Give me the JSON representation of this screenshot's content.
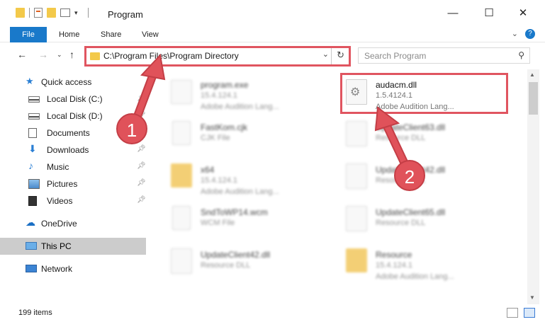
{
  "window": {
    "title": "Program",
    "minimize_glyph": "—",
    "maximize_glyph": "☐",
    "close_glyph": "✕"
  },
  "ribbon": {
    "tabs": [
      "File",
      "Home",
      "Share",
      "View"
    ],
    "help_glyph": "?"
  },
  "address": {
    "path": "C:\\Program Files\\Program Directory"
  },
  "search": {
    "placeholder": "Search Program"
  },
  "sidebar": {
    "items": [
      {
        "label": "Quick access",
        "icon": "star-icon"
      },
      {
        "label": "Local Disk (C:)",
        "icon": "drive-icon"
      },
      {
        "label": "Local Disk (D:)",
        "icon": "drive-icon"
      },
      {
        "label": "Documents",
        "icon": "documents-icon"
      },
      {
        "label": "Downloads",
        "icon": "download-icon"
      },
      {
        "label": "Music",
        "icon": "music-icon"
      },
      {
        "label": "Pictures",
        "icon": "pictures-icon"
      },
      {
        "label": "Videos",
        "icon": "videos-icon"
      },
      {
        "label": "OneDrive",
        "icon": "cloud-icon"
      },
      {
        "label": "This PC",
        "icon": "computer-icon"
      },
      {
        "label": "Network",
        "icon": "network-icon"
      }
    ]
  },
  "files": [
    {
      "name": "program.exe",
      "line1": "15.4.124.1",
      "line2": "Adobe Audition Lang..."
    },
    {
      "name": "audacm.dll",
      "line1": "1.5.4124.1",
      "line2": "Adobe Audition Lang..."
    },
    {
      "name": "FastKom.cjk",
      "line1": "CJK File",
      "line2": ""
    },
    {
      "name": "UpdateClient63.dll",
      "line1": "Resource DLL",
      "line2": ""
    },
    {
      "name": "x64",
      "line1": "15.4.124.1",
      "line2": "Adobe Audition Lang..."
    },
    {
      "name": "UpdateClient42.dll",
      "line1": "Resource DLL",
      "line2": ""
    },
    {
      "name": "SndToWP14.wcm",
      "line1": "WCM File",
      "line2": ""
    },
    {
      "name": "UpdateClient65.dll",
      "line1": "Resource DLL",
      "line2": ""
    },
    {
      "name": "UpdateClient42.dll",
      "line1": "Resource DLL",
      "line2": ""
    },
    {
      "name": "Resource",
      "line1": "15.4.124.1",
      "line2": "Adobe Audition Lang..."
    }
  ],
  "status": {
    "item_count": "199 items"
  },
  "callouts": [
    "1",
    "2"
  ],
  "colors": {
    "accent": "#1979ca",
    "highlight": "#e05560"
  }
}
